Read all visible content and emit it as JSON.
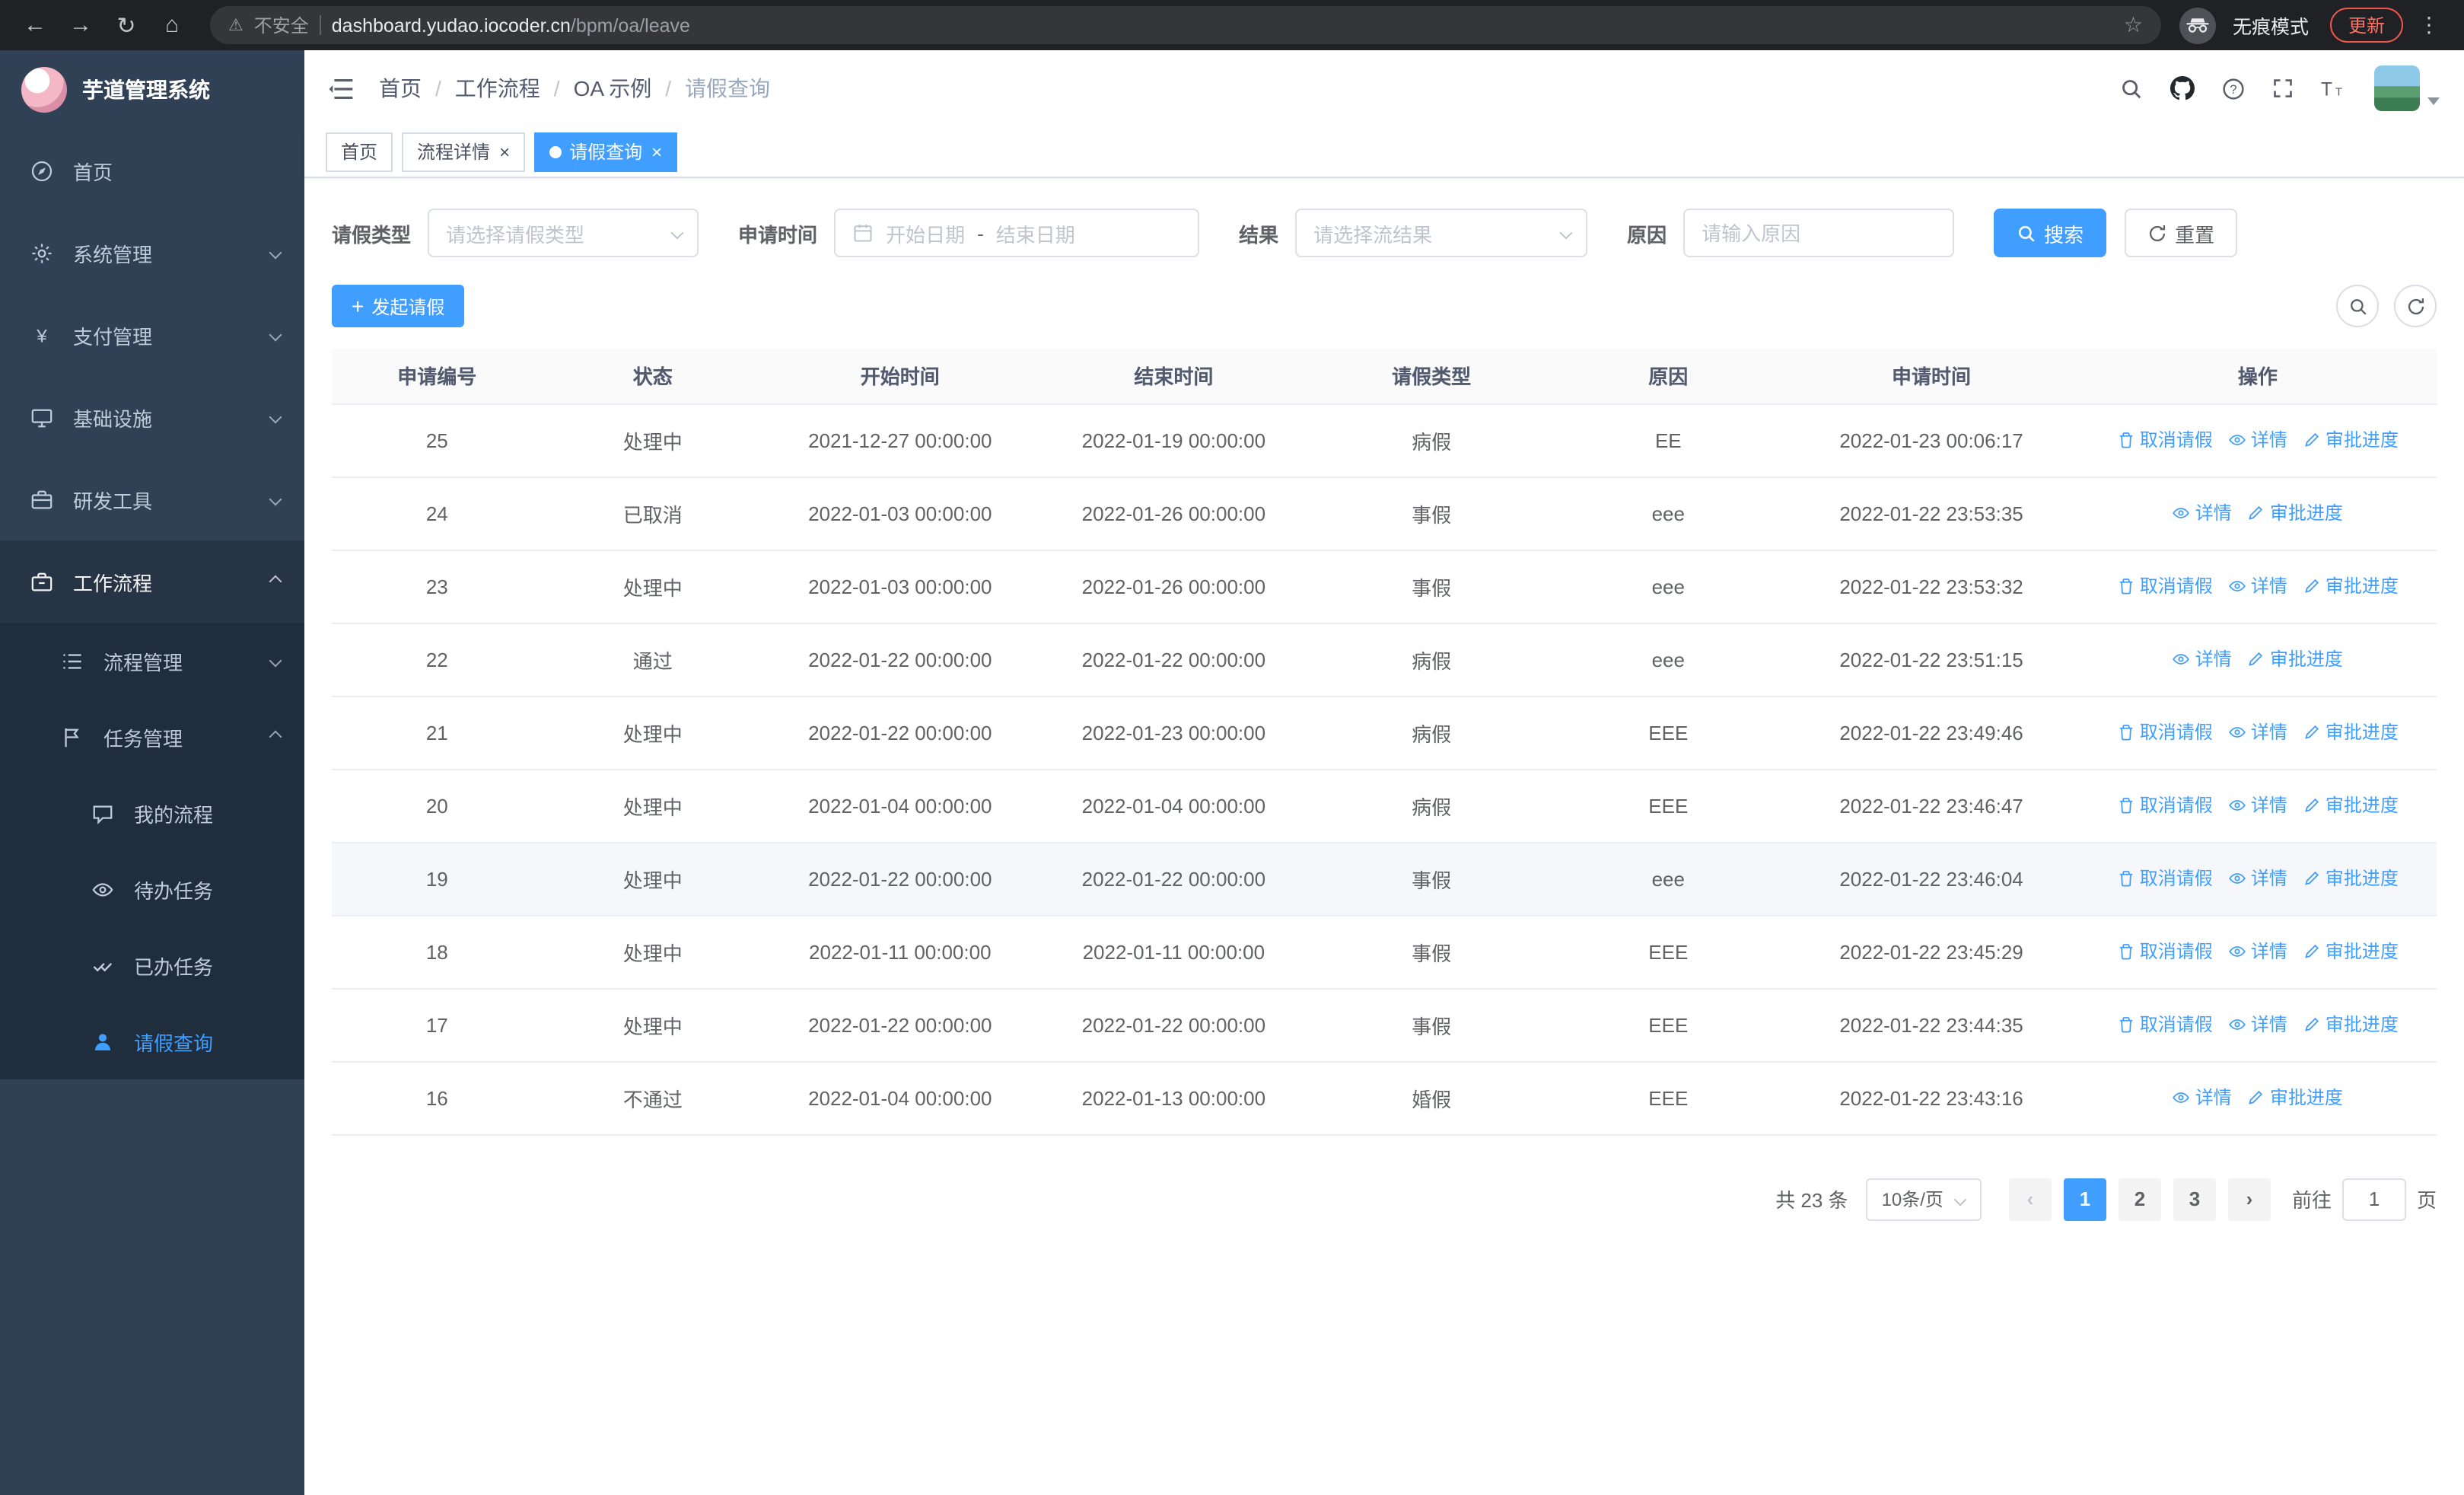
{
  "browser": {
    "security_warning": "不安全",
    "url_host": "dashboard.yudao.iocoder.cn",
    "url_path": "/bpm/oa/leave",
    "incognito_label": "无痕模式",
    "update_label": "更新"
  },
  "sidebar": {
    "logo_title": "芋道管理系统",
    "menu": [
      {
        "label": "首页"
      },
      {
        "label": "系统管理"
      },
      {
        "label": "支付管理"
      },
      {
        "label": "基础设施"
      },
      {
        "label": "研发工具"
      },
      {
        "label": "工作流程"
      }
    ],
    "submenu": [
      {
        "label": "流程管理"
      },
      {
        "label": "任务管理"
      }
    ],
    "task_menu": [
      {
        "label": "我的流程"
      },
      {
        "label": "待办任务"
      },
      {
        "label": "已办任务"
      },
      {
        "label": "请假查询"
      }
    ]
  },
  "breadcrumb": {
    "items": [
      "首页",
      "工作流程",
      "OA 示例",
      "请假查询"
    ],
    "separator": "/"
  },
  "tabs": [
    {
      "label": "首页"
    },
    {
      "label": "流程详情"
    },
    {
      "label": "请假查询"
    }
  ],
  "filters": {
    "leave_type_label": "请假类型",
    "leave_type_placeholder": "请选择请假类型",
    "apply_time_label": "申请时间",
    "start_date_placeholder": "开始日期",
    "date_separator": "-",
    "end_date_placeholder": "结束日期",
    "result_label": "结果",
    "result_placeholder": "请选择流结果",
    "reason_label": "原因",
    "reason_placeholder": "请输入原因",
    "search_label": "搜索",
    "reset_label": "重置"
  },
  "toolbar": {
    "create_label": "发起请假"
  },
  "table": {
    "columns": [
      "申请编号",
      "状态",
      "开始时间",
      "结束时间",
      "请假类型",
      "原因",
      "申请时间",
      "操作"
    ],
    "action_labels": {
      "cancel": "取消请假",
      "detail": "详情",
      "progress": "审批进度"
    },
    "rows": [
      {
        "id": "25",
        "status": "处理中",
        "start": "2021-12-27 00:00:00",
        "end": "2022-01-19 00:00:00",
        "type": "病假",
        "reason": "EE",
        "applied": "2022-01-23 00:06:17",
        "actions": [
          "cancel",
          "detail",
          "progress"
        ],
        "highlight": false
      },
      {
        "id": "24",
        "status": "已取消",
        "start": "2022-01-03 00:00:00",
        "end": "2022-01-26 00:00:00",
        "type": "事假",
        "reason": "eee",
        "applied": "2022-01-22 23:53:35",
        "actions": [
          "detail",
          "progress"
        ],
        "highlight": false
      },
      {
        "id": "23",
        "status": "处理中",
        "start": "2022-01-03 00:00:00",
        "end": "2022-01-26 00:00:00",
        "type": "事假",
        "reason": "eee",
        "applied": "2022-01-22 23:53:32",
        "actions": [
          "cancel",
          "detail",
          "progress"
        ],
        "highlight": false
      },
      {
        "id": "22",
        "status": "通过",
        "start": "2022-01-22 00:00:00",
        "end": "2022-01-22 00:00:00",
        "type": "病假",
        "reason": "eee",
        "applied": "2022-01-22 23:51:15",
        "actions": [
          "detail",
          "progress"
        ],
        "highlight": false
      },
      {
        "id": "21",
        "status": "处理中",
        "start": "2022-01-22 00:00:00",
        "end": "2022-01-23 00:00:00",
        "type": "病假",
        "reason": "EEE",
        "applied": "2022-01-22 23:49:46",
        "actions": [
          "cancel",
          "detail",
          "progress"
        ],
        "highlight": false
      },
      {
        "id": "20",
        "status": "处理中",
        "start": "2022-01-04 00:00:00",
        "end": "2022-01-04 00:00:00",
        "type": "病假",
        "reason": "EEE",
        "applied": "2022-01-22 23:46:47",
        "actions": [
          "cancel",
          "detail",
          "progress"
        ],
        "highlight": false
      },
      {
        "id": "19",
        "status": "处理中",
        "start": "2022-01-22 00:00:00",
        "end": "2022-01-22 00:00:00",
        "type": "事假",
        "reason": "eee",
        "applied": "2022-01-22 23:46:04",
        "actions": [
          "cancel",
          "detail",
          "progress"
        ],
        "highlight": true
      },
      {
        "id": "18",
        "status": "处理中",
        "start": "2022-01-11 00:00:00",
        "end": "2022-01-11 00:00:00",
        "type": "事假",
        "reason": "EEE",
        "applied": "2022-01-22 23:45:29",
        "actions": [
          "cancel",
          "detail",
          "progress"
        ],
        "highlight": false
      },
      {
        "id": "17",
        "status": "处理中",
        "start": "2022-01-22 00:00:00",
        "end": "2022-01-22 00:00:00",
        "type": "事假",
        "reason": "EEE",
        "applied": "2022-01-22 23:44:35",
        "actions": [
          "cancel",
          "detail",
          "progress"
        ],
        "highlight": false
      },
      {
        "id": "16",
        "status": "不通过",
        "start": "2022-01-04 00:00:00",
        "end": "2022-01-13 00:00:00",
        "type": "婚假",
        "reason": "EEE",
        "applied": "2022-01-22 23:43:16",
        "actions": [
          "detail",
          "progress"
        ],
        "highlight": false
      }
    ]
  },
  "pagination": {
    "total_text": "共 23 条",
    "page_size": "10条/页",
    "pages": [
      "1",
      "2",
      "3"
    ],
    "active_page": "1",
    "prev_symbol": "‹",
    "next_symbol": "›",
    "goto_label": "前往",
    "goto_value": "1",
    "page_suffix": "页"
  },
  "colors": {
    "primary": "#409eff",
    "sidebar_bg": "#304156",
    "sidebar_sub_bg": "#1f2d3d"
  }
}
